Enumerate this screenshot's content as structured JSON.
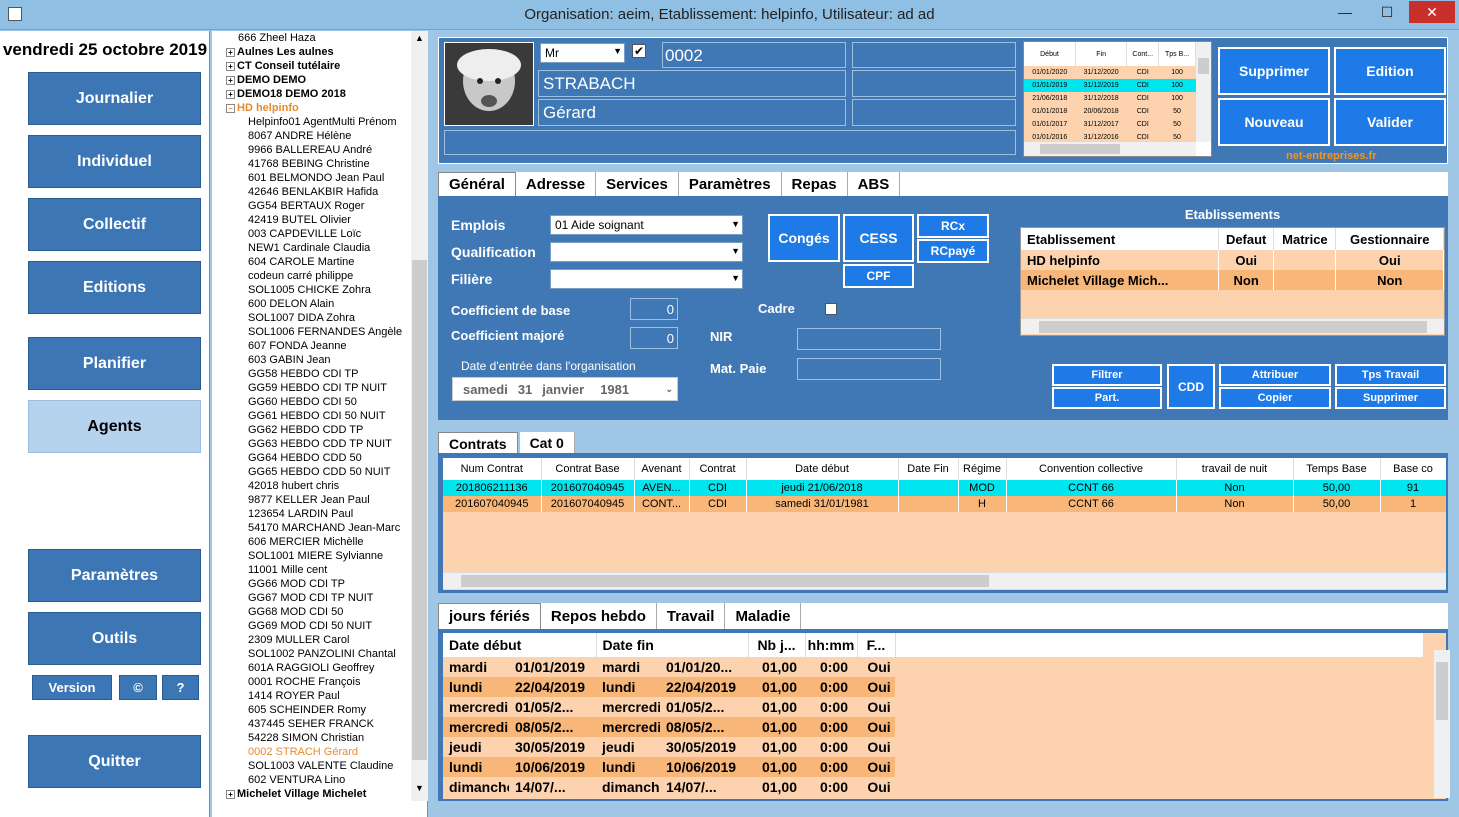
{
  "window": {
    "title": "Organisation: aeim, Etablissement: helpinfo, Utilisateur: ad ad",
    "minimize": "—",
    "maximize": "☐",
    "close": "✕"
  },
  "date_label": "vendredi 25 octobre 2019",
  "nav": [
    "Journalier",
    "Individuel",
    "Collectif",
    "Editions",
    "Planifier",
    "Agents",
    "Paramètres",
    "Outils",
    "Quitter"
  ],
  "small_buttons": {
    "version": "Version",
    "copyright": "©",
    "help": "?"
  },
  "tree": [
    {
      "label": "666 Zheel Haza",
      "type": "item"
    },
    {
      "label": "Aulnes Les aulnes",
      "type": "grp"
    },
    {
      "label": "CT Conseil tutélaire",
      "type": "grp"
    },
    {
      "label": "DEMO DEMO",
      "type": "grp"
    },
    {
      "label": "DEMO18 DEMO 2018",
      "type": "grp"
    },
    {
      "label": "HD helpinfo",
      "type": "grp-open"
    },
    {
      "label": "Helpinfo01 AgentMulti Prénom",
      "type": "item"
    },
    {
      "label": "8067 ANDRE Hélène",
      "type": "item"
    },
    {
      "label": "9966 BALLEREAU André",
      "type": "item"
    },
    {
      "label": "41768 BEBING Christine",
      "type": "item"
    },
    {
      "label": "601 BELMONDO Jean Paul",
      "type": "item"
    },
    {
      "label": "42646 BENLAKBIR Hafida",
      "type": "item"
    },
    {
      "label": "GG54 BERTAUX Roger",
      "type": "item"
    },
    {
      "label": "42419 BUTEL Olivier",
      "type": "item"
    },
    {
      "label": "003 CAPDEVILLE Loïc",
      "type": "item"
    },
    {
      "label": "NEW1 Cardinale Claudia",
      "type": "item"
    },
    {
      "label": "604 CAROLE Martine",
      "type": "item"
    },
    {
      "label": "codeun carré philippe",
      "type": "item"
    },
    {
      "label": "SOL1005 CHICKE Zohra",
      "type": "item"
    },
    {
      "label": "600 DELON Alain",
      "type": "item"
    },
    {
      "label": "SOL1007 DIDA Zohra",
      "type": "item"
    },
    {
      "label": "SOL1006 FERNANDES Angèle",
      "type": "item"
    },
    {
      "label": "607 FONDA Jeanne",
      "type": "item"
    },
    {
      "label": "603 GABIN Jean",
      "type": "item"
    },
    {
      "label": "GG58 HEBDO CDI TP",
      "type": "item"
    },
    {
      "label": "GG59 HEBDO CDI TP NUIT",
      "type": "item"
    },
    {
      "label": "GG60 HEBDO CDI 50",
      "type": "item"
    },
    {
      "label": "GG61 HEBDO CDI 50 NUIT",
      "type": "item"
    },
    {
      "label": "GG62 HEBDO CDD TP",
      "type": "item"
    },
    {
      "label": "GG63 HEBDO CDD TP NUIT",
      "type": "item"
    },
    {
      "label": "GG64 HEBDO CDD 50",
      "type": "item"
    },
    {
      "label": "GG65 HEBDO CDD 50 NUIT",
      "type": "item"
    },
    {
      "label": "42018 hubert chris",
      "type": "item"
    },
    {
      "label": "9877 KELLER Jean Paul",
      "type": "item"
    },
    {
      "label": "123654 LARDIN Paul",
      "type": "item"
    },
    {
      "label": "54170 MARCHAND Jean-Marc",
      "type": "item"
    },
    {
      "label": "606 MERCIER Michèlle",
      "type": "item"
    },
    {
      "label": "SOL1001 MIERE Sylvianne",
      "type": "item"
    },
    {
      "label": "11001 Mille cent",
      "type": "item"
    },
    {
      "label": "GG66 MOD CDI TP",
      "type": "item"
    },
    {
      "label": "GG67 MOD CDI TP NUIT",
      "type": "item"
    },
    {
      "label": "GG68 MOD CDI 50",
      "type": "item"
    },
    {
      "label": "GG69 MOD CDI 50 NUIT",
      "type": "item"
    },
    {
      "label": "2309 MULLER Carol",
      "type": "item"
    },
    {
      "label": "SOL1002 PANZOLINI  Chantal",
      "type": "item"
    },
    {
      "label": "601A RAGGIOLI Geoffrey",
      "type": "item"
    },
    {
      "label": "0001 ROCHE François",
      "type": "item"
    },
    {
      "label": "1414 ROYER Paul",
      "type": "item"
    },
    {
      "label": "605 SCHEINDER Romy",
      "type": "item"
    },
    {
      "label": "437445 SEHER FRANCK",
      "type": "item"
    },
    {
      "label": "54228 SIMON Christian",
      "type": "item"
    },
    {
      "label": "0002 STRACH Gérard",
      "type": "sel"
    },
    {
      "label": "SOL1003 VALENTE Claudine",
      "type": "item"
    },
    {
      "label": "602 VENTURA Lino",
      "type": "item"
    },
    {
      "label": "Michelet Village Michelet",
      "type": "grp"
    }
  ],
  "agent": {
    "civility": "Mr",
    "code": "0002",
    "lastname": "STRABACH",
    "firstname": "Gérard"
  },
  "mini_contracts": {
    "headers": [
      "Début",
      "Fin",
      "Cont...",
      "Tps B..."
    ],
    "rows": [
      [
        "01/01/2020",
        "31/12/2020",
        "CDI",
        "100"
      ],
      [
        "01/01/2019",
        "31/12/2019",
        "CDI",
        "100"
      ],
      [
        "21/06/2018",
        "31/12/2018",
        "CDI",
        "100"
      ],
      [
        "01/01/2018",
        "20/06/2018",
        "CDI",
        "50"
      ],
      [
        "01/01/2017",
        "31/12/2017",
        "CDI",
        "50"
      ],
      [
        "01/01/2016",
        "31/12/2016",
        "CDI",
        "50"
      ]
    ]
  },
  "actions": {
    "delete": "Supprimer",
    "edit": "Edition",
    "new": "Nouveau",
    "validate": "Valider",
    "net": "net-entreprises.fr"
  },
  "main_tabs": [
    "Général",
    "Adresse",
    "Services",
    "Paramètres",
    "Repas",
    "ABS"
  ],
  "general": {
    "emplois_label": "Emplois",
    "emplois_value": "01 Aide soignant",
    "qualification_label": "Qualification",
    "filiere_label": "Filière",
    "coef_base_label": "Coefficient de base",
    "coef_base_value": "0",
    "coef_major_label": "Coefficient majoré",
    "coef_major_value": "0",
    "date_entry_label": "Date d'entrée dans l'organisation",
    "date_entry": {
      "day": "samedi",
      "num": "31",
      "month": "janvier",
      "year": "1981"
    },
    "cadre_label": "Cadre",
    "nir_label": "NIR",
    "matpaie_label": "Mat. Paie",
    "conges": "Congés",
    "cess": "CESS",
    "rcx": "RCx",
    "rcpaye": "RCpayé",
    "cpf": "CPF"
  },
  "etablissements": {
    "title": "Etablissements",
    "headers": [
      "Etablissement",
      "Defaut",
      "Matrice",
      "Gestionnaire"
    ],
    "rows": [
      [
        "HD helpinfo",
        "Oui",
        "",
        "Oui"
      ],
      [
        "Michelet Village Mich...",
        "Non",
        "",
        "Non"
      ]
    ]
  },
  "etab_buttons": {
    "filtrer": "Filtrer",
    "part": "Part.",
    "cdd": "CDD",
    "attribuer": "Attribuer",
    "copier": "Copier",
    "tps": "Tps Travail",
    "supprimer": "Supprimer"
  },
  "contract_tabs": [
    "Contrats",
    "Cat 0"
  ],
  "contracts": {
    "headers": [
      "Num Contrat",
      "Contrat Base",
      "Avenant",
      "Contrat",
      "Date début",
      "Date Fin",
      "Régime",
      "Convention collective",
      "travail de nuit",
      "Temps Base",
      "Base co"
    ],
    "rows": [
      [
        "201806211136",
        "201607040945",
        "AVEN...",
        "CDI",
        "jeudi      21/06/2018",
        "",
        "MOD",
        "CCNT 66",
        "Non",
        "50,00",
        "91"
      ],
      [
        "201607040945",
        "201607040945",
        "CONT...",
        "CDI",
        "samedi      31/01/1981",
        "",
        "H",
        "CCNT 66",
        "Non",
        "50,00",
        "1"
      ]
    ]
  },
  "bottom_tabs": [
    "jours fériés",
    "Repos hebdo",
    "Travail",
    "Maladie"
  ],
  "holidays": {
    "headers": [
      "Date début",
      "Date fin",
      "Nb j...",
      "hh:mm",
      "F..."
    ],
    "rows": [
      [
        "mardi",
        "01/01/2019",
        "mardi",
        "01/01/20...",
        "01,00",
        "0:00",
        "Oui"
      ],
      [
        "lundi",
        "22/04/2019",
        "lundi",
        "22/04/2019",
        "01,00",
        "0:00",
        "Oui"
      ],
      [
        "mercredi",
        "01/05/2...",
        "mercredi",
        "01/05/2...",
        "01,00",
        "0:00",
        "Oui"
      ],
      [
        "mercredi",
        "08/05/2...",
        "mercredi",
        "08/05/2...",
        "01,00",
        "0:00",
        "Oui"
      ],
      [
        "jeudi",
        "30/05/2019",
        "jeudi",
        "30/05/2019",
        "01,00",
        "0:00",
        "Oui"
      ],
      [
        "lundi",
        "10/06/2019",
        "lundi",
        "10/06/2019",
        "01,00",
        "0:00",
        "Oui"
      ],
      [
        "dimanche",
        "14/07/...",
        "dimanche",
        "14/07/...",
        "01,00",
        "0:00",
        "Oui"
      ]
    ]
  }
}
